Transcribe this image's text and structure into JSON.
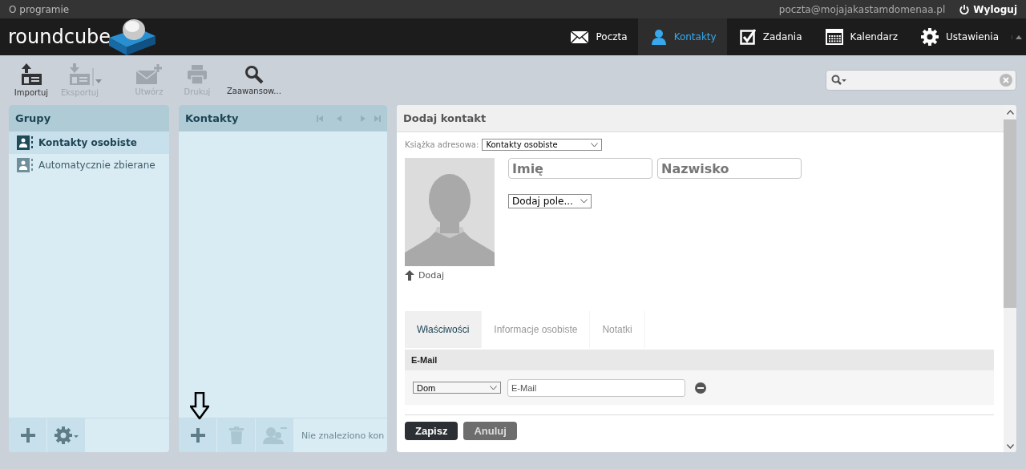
{
  "topbar": {
    "about": "O programie",
    "user": "poczta@mojajakastamdomenaa.pl",
    "logout": "Wyloguj"
  },
  "logo": "roundcube",
  "nav": [
    {
      "label": "Poczta",
      "kind": "mail",
      "selected": false
    },
    {
      "label": "Kontakty",
      "kind": "person",
      "selected": true
    },
    {
      "label": "Zadania",
      "kind": "check",
      "selected": false
    },
    {
      "label": "Kalendarz",
      "kind": "calendar",
      "selected": false
    },
    {
      "label": "Ustawienia",
      "kind": "gear",
      "selected": false
    }
  ],
  "toolbar": [
    {
      "label": "Importuj",
      "kind": "import",
      "disabled": false,
      "menu": false
    },
    {
      "label": "Eksportuj",
      "kind": "export",
      "disabled": true,
      "menu": true
    },
    {
      "label": "Utwórz",
      "kind": "compose",
      "disabled": true,
      "menu": false
    },
    {
      "label": "Drukuj",
      "kind": "print",
      "disabled": true,
      "menu": false
    },
    {
      "label": "Zaawansow...",
      "kind": "search",
      "disabled": false,
      "menu": false
    }
  ],
  "groups": {
    "title": "Grupy",
    "items": [
      {
        "label": "Kontakty osobiste",
        "selected": true
      },
      {
        "label": "Automatycznie zbierane",
        "selected": false
      }
    ],
    "footer": [
      {
        "kind": "add",
        "disabled": false
      },
      {
        "kind": "gear",
        "disabled": false
      }
    ]
  },
  "contacts": {
    "title": "Kontakty",
    "footer": [
      {
        "kind": "add",
        "disabled": false
      },
      {
        "kind": "trash",
        "disabled": true
      },
      {
        "kind": "remove-user",
        "disabled": true
      }
    ],
    "status": "Nie znaleziono kon"
  },
  "form": {
    "title": "Dodaj kontakt",
    "addressbook_label": "Książka adresowa:",
    "addressbook": "Kontakty osobiste",
    "first_name": {
      "placeholder": "Imię"
    },
    "last_name": {
      "placeholder": "Nazwisko"
    },
    "add_field": "Dodaj pole...",
    "upload": "Dodaj",
    "tabs": [
      {
        "label": "Właściwości",
        "selected": true
      },
      {
        "label": "Informacje osobiste",
        "selected": false
      },
      {
        "label": "Notatki",
        "selected": false
      }
    ],
    "section": "E-Mail",
    "email_type": "Dom",
    "email": {
      "placeholder": "E-Mail"
    },
    "save": "Zapisz",
    "cancel": "Anuluj"
  }
}
